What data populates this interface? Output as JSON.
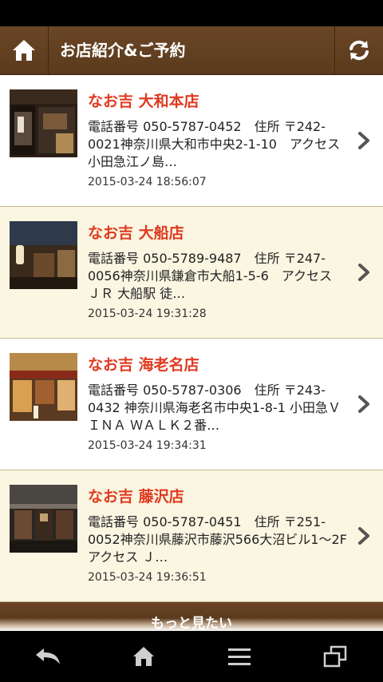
{
  "header": {
    "title": "お店紹介&ご予約",
    "home_icon": "home-icon",
    "refresh_icon": "refresh-icon"
  },
  "shops": [
    {
      "name": "なお吉 大和本店",
      "description": "電話番号 050-5787-0452　住所 〒242-0021神奈川県大和市中央2-1-10　アクセス 小田急江ノ島…",
      "date": "2015-03-24 18:56:07"
    },
    {
      "name": "なお吉 大船店",
      "description": "電話番号 050-5789-9487　住所 〒247-0056神奈川県鎌倉市大船1-5-6　アクセス ＪＲ 大船駅 徒…",
      "date": "2015-03-24 19:31:28"
    },
    {
      "name": "なお吉 海老名店",
      "description": "電話番号 050-5787-0306　住所 〒243-0432 神奈川県海老名市中央1-8-1 小田急ＶＩＮＡ ＷＡＬＫ２番…",
      "date": "2015-03-24 19:34:31"
    },
    {
      "name": "なお吉 藤沢店",
      "description": "電話番号 050-5787-0451　住所 〒251-0052神奈川県藤沢市藤沢566大沼ビル1～2F　アクセス Ｊ…",
      "date": "2015-03-24 19:36:51"
    }
  ],
  "more_button": {
    "label": "もっと見たい"
  },
  "nav": {
    "icons": [
      "back-icon",
      "home-icon",
      "menu-icon",
      "recent-apps-icon"
    ]
  },
  "colors": {
    "header_bg": "#5b3a1d",
    "shop_name": "#e03a1f",
    "item_alt_bg": "#faf6e2"
  }
}
